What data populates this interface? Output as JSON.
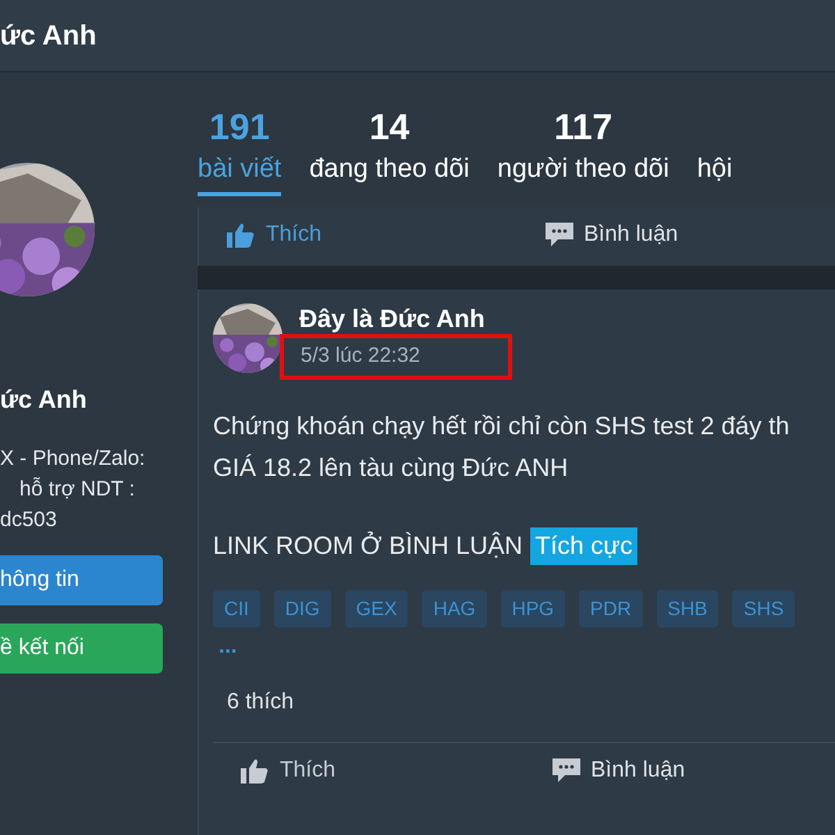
{
  "header": {
    "title": "ức Anh"
  },
  "profile": {
    "name": "ức Anh",
    "bio": [
      "X - Phone/Zalo:",
      "hỗ trợ NDT :",
      "dc503"
    ],
    "buttons": [
      {
        "label": "hông tin",
        "kind": "primary"
      },
      {
        "label": "ề kết nối",
        "kind": "success"
      }
    ]
  },
  "stats": [
    {
      "count": "191",
      "label": "bài viết",
      "selected": true
    },
    {
      "count": "14",
      "label": "đang theo dõi",
      "selected": false
    },
    {
      "count": "117",
      "label": "người theo dõi",
      "selected": false
    },
    {
      "label": "hội",
      "selected": false
    }
  ],
  "prev_post_actions": [
    "Thích",
    "Bình luận"
  ],
  "post": {
    "author": "Đây là Đức Anh",
    "date": "5/3 lúc 22:32",
    "date_highlighted": true,
    "lines": [
      "Chứng khoán chạy hết rồi chỉ còn SHS test 2 đáy th",
      "GIÁ 18.2 lên tàu cùng Đức ANH"
    ],
    "link_line": "LINK ROOM Ở BÌNH LUẬN",
    "sentiment": "Tích cực",
    "tags": [
      "CII",
      "DIG",
      "GEX",
      "HAG",
      "HPG",
      "PDR",
      "SHB",
      "SHS"
    ],
    "more": "...",
    "likes": "6 thích",
    "actions": [
      "Thích",
      "Bình luận"
    ]
  }
}
